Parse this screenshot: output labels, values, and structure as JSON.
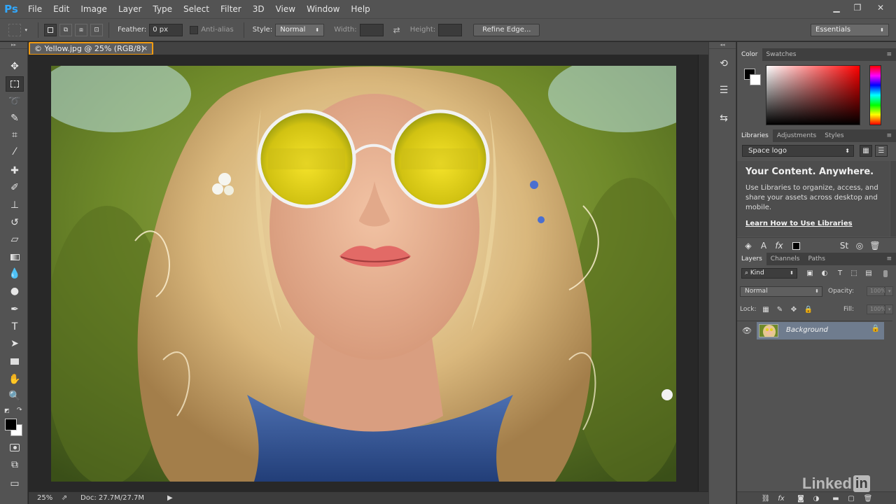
{
  "app": {
    "logo": "Ps"
  },
  "menu": [
    "File",
    "Edit",
    "Image",
    "Layer",
    "Type",
    "Select",
    "Filter",
    "3D",
    "View",
    "Window",
    "Help"
  ],
  "window_controls": {
    "minimize": "▁",
    "restore": "❐",
    "close": "✕"
  },
  "options": {
    "feather_label": "Feather:",
    "feather_value": "0 px",
    "antialias_label": "Anti-alias",
    "style_label": "Style:",
    "style_value": "Normal",
    "width_label": "Width:",
    "swap_icon": "⇄",
    "height_label": "Height:",
    "refine_edge": "Refine Edge...",
    "workspace": "Essentials"
  },
  "document": {
    "tab_title": "© Yellow.jpg @ 25% (RGB/8)",
    "tab_close": "×"
  },
  "status": {
    "zoom": "25%",
    "doc_info": "Doc: 27.7M/27.7M",
    "arrow": "▶"
  },
  "color_panel": {
    "tabs": [
      "Color",
      "Swatches"
    ]
  },
  "libraries_panel": {
    "tabs": [
      "Libraries",
      "Adjustments",
      "Styles"
    ],
    "library_select": "Space logo",
    "heading": "Your Content. Anywhere.",
    "body": "Use Libraries to organize, access, and share your assets across desktop and mobile.",
    "link": "Learn How to Use Libraries"
  },
  "layers_panel": {
    "tabs": [
      "Layers",
      "Channels",
      "Paths"
    ],
    "filter_kind": "Kind",
    "blend_mode": "Normal",
    "opacity_label": "Opacity:",
    "opacity_value": "100%",
    "lock_label": "Lock:",
    "fill_label": "Fill:",
    "fill_value": "100%",
    "layer_name": "Background"
  },
  "watermark": {
    "text": "Linked",
    "in": "in"
  },
  "colors": {
    "accent": "#f39c12",
    "layer_selected": "#6f7c8e",
    "ps_blue": "#31a8ff"
  }
}
